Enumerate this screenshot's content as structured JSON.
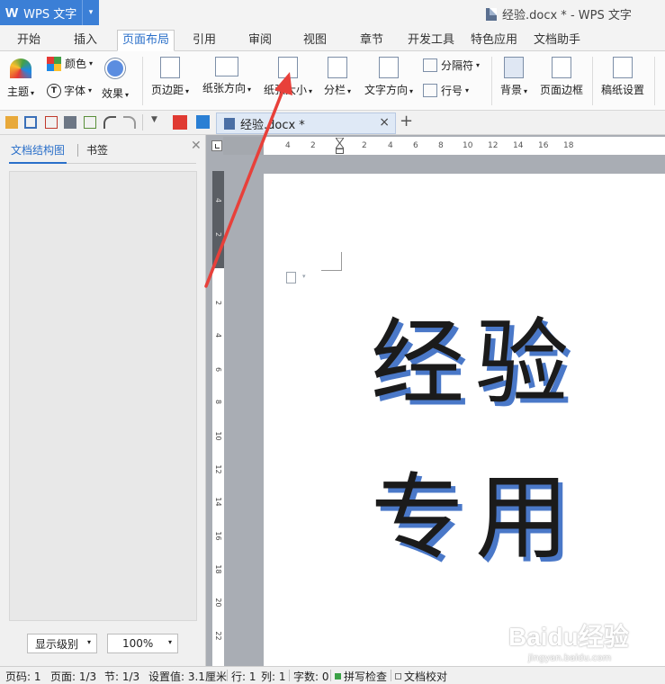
{
  "app": {
    "logo": "W",
    "name": "WPS 文字",
    "dropdown": "▾"
  },
  "window_title": "经验.docx * - WPS 文字",
  "tabs": [
    {
      "label": "开始"
    },
    {
      "label": "插入"
    },
    {
      "label": "页面布局"
    },
    {
      "label": "引用"
    },
    {
      "label": "审阅"
    },
    {
      "label": "视图"
    },
    {
      "label": "章节"
    },
    {
      "label": "开发工具"
    },
    {
      "label": "特色应用"
    },
    {
      "label": "文档助手"
    }
  ],
  "active_tab": "页面布局",
  "ribbon": {
    "theme": "主题",
    "color": "颜色",
    "font": "字体",
    "font_icon": "T",
    "effect": "效果",
    "margins": "页边距",
    "orientation": "纸张方向",
    "size": "纸张大小",
    "columns": "分栏",
    "text_direction": "文字方向",
    "separator": "分隔符",
    "line_number": "行号",
    "background": "背景",
    "page_border": "页面边框",
    "manuscript": "稿纸设置",
    "arrow": "▾"
  },
  "document_tab": {
    "label": "经验.docx *",
    "close": "×"
  },
  "new_tab": "+",
  "side_panel": {
    "tab_outline": "文档结构图",
    "tab_bookmark": "书签",
    "close": "✕",
    "level_select": "显示级别",
    "zoom_select": "100%"
  },
  "ruler": {
    "h_labels": [
      "4",
      "2",
      "2",
      "4",
      "6",
      "8",
      "10",
      "12",
      "14",
      "16",
      "18"
    ],
    "v_labels": [
      "4",
      "2",
      "2",
      "4",
      "6",
      "8",
      "10",
      "12",
      "14",
      "16",
      "18",
      "20",
      "22"
    ]
  },
  "document": {
    "line1": "经验",
    "line2": "专用"
  },
  "watermark": {
    "main": "Baidu经验",
    "sub": "jingyan.baidu.com"
  },
  "status": {
    "page": "页码: 1",
    "pages": "页面: 1/3",
    "section": "节: 1/3",
    "setting": "设置值: 3.1厘米",
    "row": "行: 1",
    "col": "列: 1",
    "words": "字数: 0",
    "spell": "拼写检查",
    "proof": "文档校对"
  },
  "colors": {
    "accent": "#3b7fd6",
    "arrow": "#e8403a",
    "text_shadow": "#4a78c8"
  }
}
